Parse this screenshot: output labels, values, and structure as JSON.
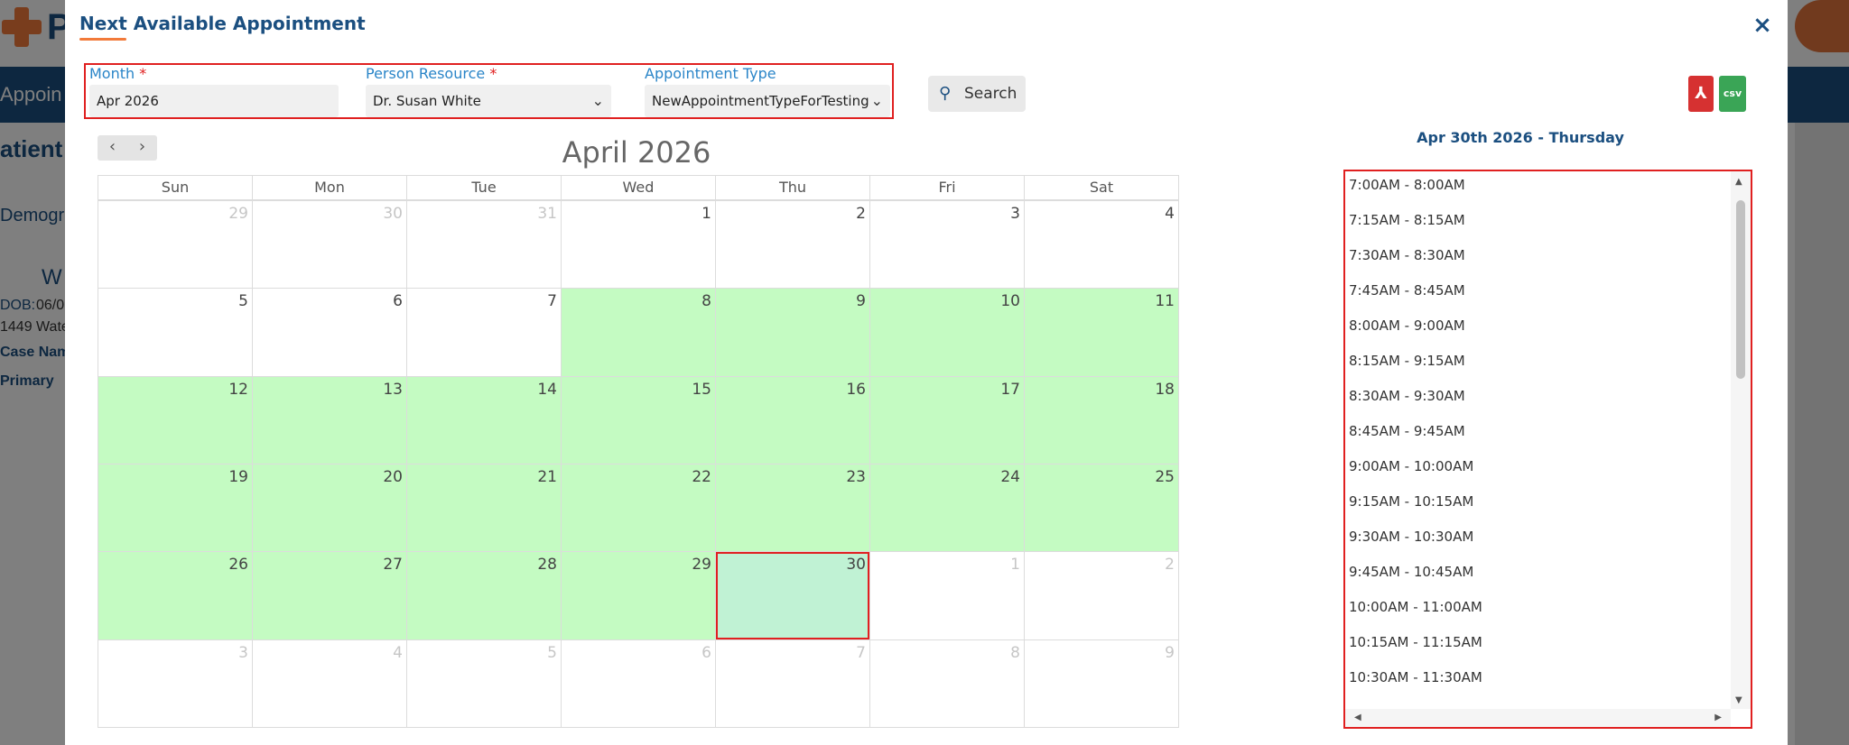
{
  "background": {
    "nav_label": "Appoin",
    "section_label": "atient",
    "demographics_label": "Demogr",
    "patient_initial": "W",
    "dob_label": "DOB:",
    "dob_value": "06/0",
    "address_fragment": "1449 Wate",
    "case_label": "Case Nam",
    "primary_label": "Primary"
  },
  "modal": {
    "title": "Next Available Appointment",
    "close_icon": "close-icon"
  },
  "filters": {
    "month_label": "Month",
    "month_value": "Apr 2026",
    "person_label": "Person Resource",
    "person_value": "Dr. Susan White",
    "appt_type_label": "Appointment Type",
    "appt_type_value": "NewAppointmentTypeForTesting",
    "required_mark": "*"
  },
  "search": {
    "label": "Search",
    "icon": "search-icon"
  },
  "exports": {
    "pdf_icon": "pdf-icon",
    "csv_icon": "csv-icon",
    "csv_text": "csv"
  },
  "calendar": {
    "title": "April 2026",
    "prev": "‹",
    "next": "›",
    "weekdays": [
      "Sun",
      "Mon",
      "Tue",
      "Wed",
      "Thu",
      "Fri",
      "Sat"
    ],
    "days": [
      {
        "d": "29",
        "other": true,
        "avail": false
      },
      {
        "d": "30",
        "other": true,
        "avail": false
      },
      {
        "d": "31",
        "other": true,
        "avail": false
      },
      {
        "d": "1",
        "other": false,
        "avail": false
      },
      {
        "d": "2",
        "other": false,
        "avail": false
      },
      {
        "d": "3",
        "other": false,
        "avail": false
      },
      {
        "d": "4",
        "other": false,
        "avail": false
      },
      {
        "d": "5",
        "other": false,
        "avail": false
      },
      {
        "d": "6",
        "other": false,
        "avail": false
      },
      {
        "d": "7",
        "other": false,
        "avail": false
      },
      {
        "d": "8",
        "other": false,
        "avail": true
      },
      {
        "d": "9",
        "other": false,
        "avail": true
      },
      {
        "d": "10",
        "other": false,
        "avail": true
      },
      {
        "d": "11",
        "other": false,
        "avail": true
      },
      {
        "d": "12",
        "other": false,
        "avail": true
      },
      {
        "d": "13",
        "other": false,
        "avail": true
      },
      {
        "d": "14",
        "other": false,
        "avail": true
      },
      {
        "d": "15",
        "other": false,
        "avail": true
      },
      {
        "d": "16",
        "other": false,
        "avail": true
      },
      {
        "d": "17",
        "other": false,
        "avail": true
      },
      {
        "d": "18",
        "other": false,
        "avail": true
      },
      {
        "d": "19",
        "other": false,
        "avail": true
      },
      {
        "d": "20",
        "other": false,
        "avail": true
      },
      {
        "d": "21",
        "other": false,
        "avail": true
      },
      {
        "d": "22",
        "other": false,
        "avail": true
      },
      {
        "d": "23",
        "other": false,
        "avail": true
      },
      {
        "d": "24",
        "other": false,
        "avail": true
      },
      {
        "d": "25",
        "other": false,
        "avail": true
      },
      {
        "d": "26",
        "other": false,
        "avail": true
      },
      {
        "d": "27",
        "other": false,
        "avail": true
      },
      {
        "d": "28",
        "other": false,
        "avail": true
      },
      {
        "d": "29",
        "other": false,
        "avail": true
      },
      {
        "d": "30",
        "other": false,
        "avail": true,
        "selected": true
      },
      {
        "d": "1",
        "other": true,
        "avail": false
      },
      {
        "d": "2",
        "other": true,
        "avail": false
      },
      {
        "d": "3",
        "other": true,
        "avail": false
      },
      {
        "d": "4",
        "other": true,
        "avail": false
      },
      {
        "d": "5",
        "other": true,
        "avail": false
      },
      {
        "d": "6",
        "other": true,
        "avail": false
      },
      {
        "d": "7",
        "other": true,
        "avail": false
      },
      {
        "d": "8",
        "other": true,
        "avail": false
      },
      {
        "d": "9",
        "other": true,
        "avail": false
      }
    ]
  },
  "slots": {
    "heading": "Apr 30th 2026 - Thursday",
    "items": [
      "7:00AM - 8:00AM",
      "7:15AM - 8:15AM",
      "7:30AM - 8:30AM",
      "7:45AM - 8:45AM",
      "8:00AM - 9:00AM",
      "8:15AM - 9:15AM",
      "8:30AM - 9:30AM",
      "8:45AM - 9:45AM",
      "9:00AM - 10:00AM",
      "9:15AM - 10:15AM",
      "9:30AM - 10:30AM",
      "9:45AM - 10:45AM",
      "10:00AM - 11:00AM",
      "10:15AM - 11:15AM",
      "10:30AM - 11:30AM"
    ]
  },
  "colors": {
    "available": "#c4fbc2",
    "selected": "#c0f2d4",
    "highlight_border": "#e02020",
    "brand_blue": "#1b4f80",
    "accent_orange": "#f27a3a"
  }
}
